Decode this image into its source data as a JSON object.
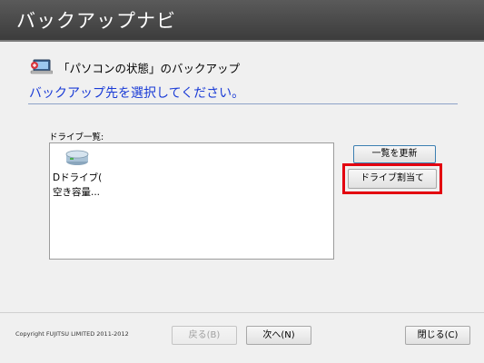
{
  "window": {
    "title": "バックアップナビ"
  },
  "section": {
    "title": "「パソコンの状態」のバックアップ",
    "icon": "pc-backup-icon"
  },
  "instruction": "バックアップ先を選択してください。",
  "drive_list": {
    "label": "ドライブ一覧:",
    "items": [
      {
        "name_line1": "Dドライブ(",
        "name_line2": "空き容量...",
        "icon": "hard-drive-icon",
        "selected": true
      }
    ]
  },
  "buttons": {
    "refresh": "一覧を更新",
    "assign_drive": "ドライブ割当て",
    "back": "戻る(B)",
    "next": "次へ(N)",
    "close": "閉じる(C)"
  },
  "footer": {
    "copyright": "Copyright FUJITSU LIMITED 2011-2012"
  },
  "colors": {
    "instruction_text": "#1a3bd6",
    "highlight_border": "#e3000f",
    "titlebar": "#4a4a4a"
  }
}
